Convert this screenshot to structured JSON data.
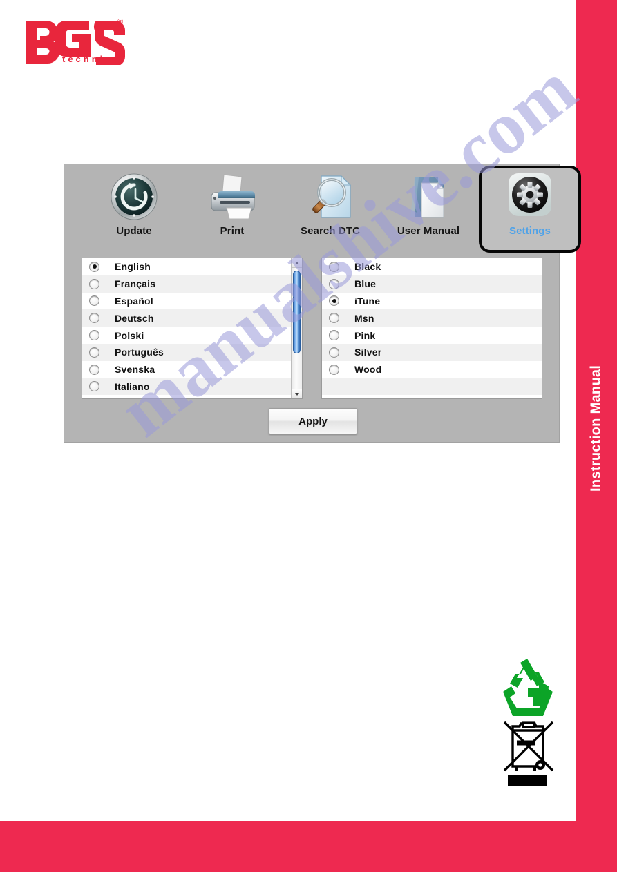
{
  "brand": {
    "logo_text": "BGS",
    "logo_sub": "technic",
    "logo_color": "#E8263C",
    "registered_mark": "®"
  },
  "sidebar": {
    "label": "Instruction Manual",
    "color": "#EE2950"
  },
  "watermark": {
    "text": "manualshive.com",
    "color": "#9a9ada"
  },
  "app": {
    "background": "#B4B4B4",
    "toolbar": {
      "items": [
        {
          "id": "update",
          "label": "Update",
          "icon": "update-clock-icon",
          "active": false
        },
        {
          "id": "print",
          "label": "Print",
          "icon": "printer-icon",
          "active": false
        },
        {
          "id": "search",
          "label": "Search DTC",
          "icon": "magnifier-doc-icon",
          "active": false
        },
        {
          "id": "manual",
          "label": "User Manual",
          "icon": "manual-folder-icon",
          "active": false
        },
        {
          "id": "settings",
          "label": "Settings",
          "icon": "gear-icon",
          "active": true
        }
      ],
      "active_label_color": "#4FA2E8"
    },
    "language_list": {
      "selected": "English",
      "items": [
        "English",
        "Français",
        "Español",
        "Deutsch",
        "Polski",
        "Português",
        "Svenska",
        "Italiano"
      ],
      "scrollbar": {
        "up_arrow": "▲",
        "down_arrow": "▼",
        "thumb_color": "#7fb4ef"
      }
    },
    "theme_list": {
      "selected": "iTune",
      "items": [
        "Black",
        "Blue",
        "iTune",
        "Msn",
        "Pink",
        "Silver",
        "Wood"
      ]
    },
    "apply_button": {
      "label": "Apply"
    }
  },
  "eco": {
    "recycle_icon": "recycling-arrows-icon",
    "recycle_color": "#0CA427",
    "weee_icon": "crossed-out-wheelie-bin-icon"
  }
}
